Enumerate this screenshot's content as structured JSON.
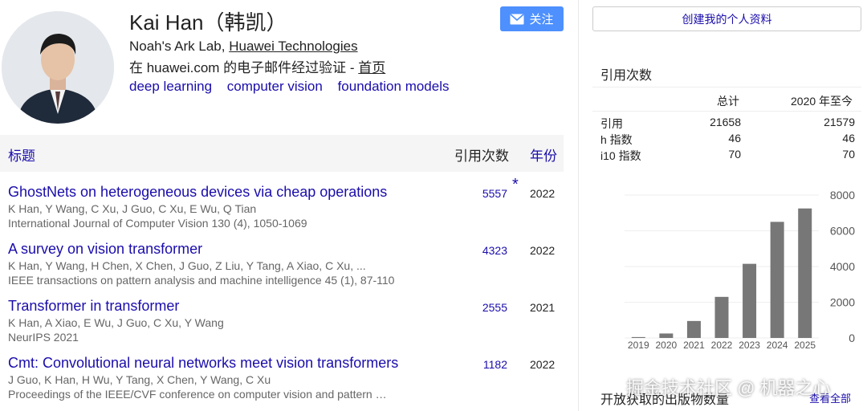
{
  "profile": {
    "name": "Kai Han（韩凯）",
    "affiliation_prefix": "Noah's Ark Lab, ",
    "affiliation_link": "Huawei Technologies",
    "verify_text": "在 huawei.com 的电子邮件经过验证 - ",
    "homepage_link": "首页",
    "interests": [
      "deep learning",
      "computer vision",
      "foundation models"
    ]
  },
  "follow_button": {
    "label": "关注",
    "icon": "mail-icon"
  },
  "table": {
    "headers": {
      "title": "标题",
      "cites": "引用次数",
      "year": "年份"
    },
    "rows": [
      {
        "title": "GhostNets on heterogeneous devices via cheap operations",
        "authors": "K Han, Y Wang, C Xu, J Guo, C Xu, E Wu, Q Tian",
        "venue": "International Journal of Computer Vision 130 (4), 1050-1069",
        "cites": "5557",
        "year": "2022",
        "star": "*"
      },
      {
        "title": "A survey on vision transformer",
        "authors": "K Han, Y Wang, H Chen, X Chen, J Guo, Z Liu, Y Tang, A Xiao, C Xu, ...",
        "venue": "IEEE transactions on pattern analysis and machine intelligence 45 (1), 87-110",
        "cites": "4323",
        "year": "2022"
      },
      {
        "title": "Transformer in transformer",
        "authors": "K Han, A Xiao, E Wu, J Guo, C Xu, Y Wang",
        "venue": "NeurIPS 2021",
        "cites": "2555",
        "year": "2021"
      },
      {
        "title": "Cmt: Convolutional neural networks meet vision transformers",
        "authors": "J Guo, K Han, H Wu, Y Tang, X Chen, Y Wang, C Xu",
        "venue": "Proceedings of the IEEE/CVF conference on computer vision and pattern …",
        "cites": "1182",
        "year": "2022"
      }
    ]
  },
  "right_panel": {
    "create_button": "创建我的个人资料",
    "stats_title": "引用次数",
    "col_total": "总计",
    "col_since": "2020 年至今",
    "stats": [
      {
        "label": "引用",
        "total": "21658",
        "since": "21579"
      },
      {
        "label": "h 指数",
        "total": "46",
        "since": "46"
      },
      {
        "label": "i10 指数",
        "total": "70",
        "since": "70"
      }
    ],
    "footer_text": "开放获取的出版物数量",
    "view_all": "查看全部",
    "watermark": "掘金技术社区 @ 机器之心"
  },
  "chart_data": {
    "type": "bar",
    "categories": [
      "2019",
      "2020",
      "2021",
      "2022",
      "2023",
      "2024",
      "2025"
    ],
    "values": [
      50,
      250,
      950,
      2300,
      4150,
      6500,
      7250
    ],
    "ylim": [
      0,
      8000
    ],
    "yticks": [
      0,
      2000,
      4000,
      6000,
      8000
    ],
    "grid": true,
    "color": "#777777"
  }
}
